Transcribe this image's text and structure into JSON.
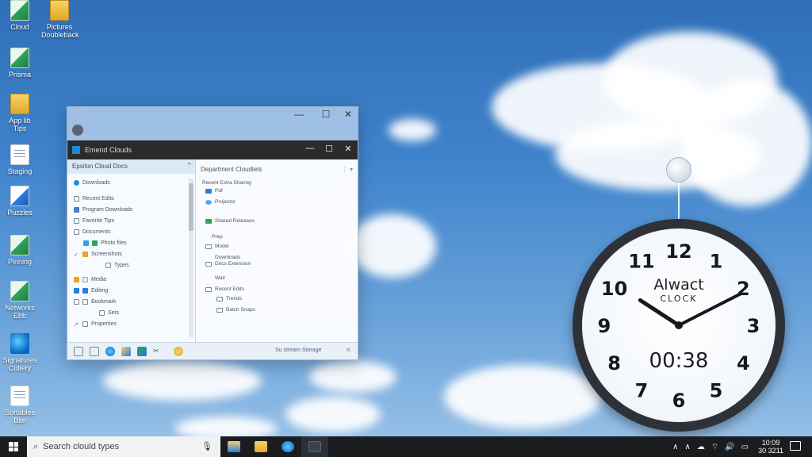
{
  "desktop": {
    "icons": [
      {
        "label": "Cloud",
        "icon": "green-app-icon"
      },
      {
        "label": "Pictures Doubleback",
        "icon": "folder-icon"
      },
      {
        "label": "Prisma",
        "icon": "green-app-icon"
      },
      {
        "label": "App lib Tips",
        "icon": "folder-icon"
      },
      {
        "label": "Staging",
        "icon": "document-icon"
      },
      {
        "label": "Puzzles",
        "icon": "blue-doc-icon"
      },
      {
        "label": "Pinning",
        "icon": "green-app-icon"
      },
      {
        "label": "Networks Ebb",
        "icon": "green-app-icon"
      },
      {
        "label": "Signatures Cutlery",
        "icon": "edge-icon"
      },
      {
        "label": "Sortables Bite",
        "icon": "document-icon"
      }
    ]
  },
  "window": {
    "title": "Emend Clouds",
    "outer_controls": [
      "—",
      "☐",
      "✕"
    ],
    "inner_controls": [
      "—",
      "☐",
      "✕"
    ],
    "left_pane": {
      "header": "Epsilon Cloud Docs",
      "items": [
        "Downloads",
        "Recent Edits",
        "Program Downloads",
        "Favorite Tips",
        "Documents",
        "Photo files",
        "Screenshots",
        "Types",
        "Media",
        "Editing",
        "Bookmark",
        "Sets",
        "Properties"
      ]
    },
    "right_pane": {
      "title": "Department Cloudlets",
      "items": [
        "Recent Extra Sharing",
        "Pdf",
        "Projector",
        "Shared Releases",
        "Prep",
        "Model",
        "Downloads",
        "Docs Extension",
        "Wait",
        "Recent Edits",
        "Trends",
        "Batch Snaps"
      ]
    },
    "status_text": "Su stream Storage"
  },
  "clock": {
    "brand": "Alwact",
    "subbrand": "CLOCK",
    "digital_time": "00:38",
    "numerals": [
      "12",
      "1",
      "2",
      "3",
      "4",
      "5",
      "6",
      "7",
      "8",
      "9",
      "10",
      "11"
    ],
    "hour_hand_hours": 10.1,
    "minute_hand_minutes": 10.5
  },
  "taskbar": {
    "search_placeholder": "Search clould types",
    "apps": [
      "file-explorer-icon",
      "folder-icon",
      "edge-icon",
      "terminal-icon"
    ],
    "tray_time": "10:09",
    "tray_date": "30 3211"
  },
  "colors": {
    "sky_top": "#2f6fb8",
    "taskbar": "#1a1c20",
    "window_header": "#2b2b2b",
    "accent": "#1f88d8"
  }
}
